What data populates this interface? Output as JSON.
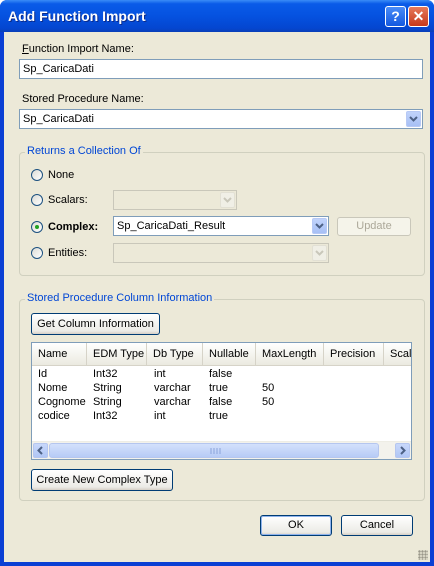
{
  "window": {
    "title": "Add Function Import",
    "help_label": "?",
    "close_label": "✕"
  },
  "function_import": {
    "label": "Function Import Name:",
    "value": "Sp_CaricaDati"
  },
  "stored_procedure": {
    "label": "Stored Procedure Name:",
    "value": "Sp_CaricaDati"
  },
  "returns": {
    "group_title": "Returns a Collection Of",
    "none_label": "None",
    "scalars_label": "Scalars:",
    "scalars_value": "",
    "complex_label": "Complex:",
    "complex_value": "Sp_CaricaDati_Result",
    "update_label": "Update",
    "entities_label": "Entities:",
    "entities_value": "",
    "selected": "complex"
  },
  "columns_info": {
    "group_title": "Stored Procedure Column Information",
    "get_button": "Get Column Information",
    "headers": [
      "Name",
      "EDM Type",
      "Db Type",
      "Nullable",
      "MaxLength",
      "Precision",
      "Scal"
    ],
    "rows": [
      [
        "Id",
        "Int32",
        "int",
        "false",
        "",
        "",
        ""
      ],
      [
        "Nome",
        "String",
        "varchar",
        "true",
        "50",
        "",
        ""
      ],
      [
        "Cognome",
        "String",
        "varchar",
        "false",
        "50",
        "",
        ""
      ],
      [
        "codice",
        "Int32",
        "int",
        "true",
        "",
        "",
        ""
      ]
    ],
    "create_button": "Create New Complex Type"
  },
  "ok_label": "OK",
  "cancel_label": "Cancel"
}
